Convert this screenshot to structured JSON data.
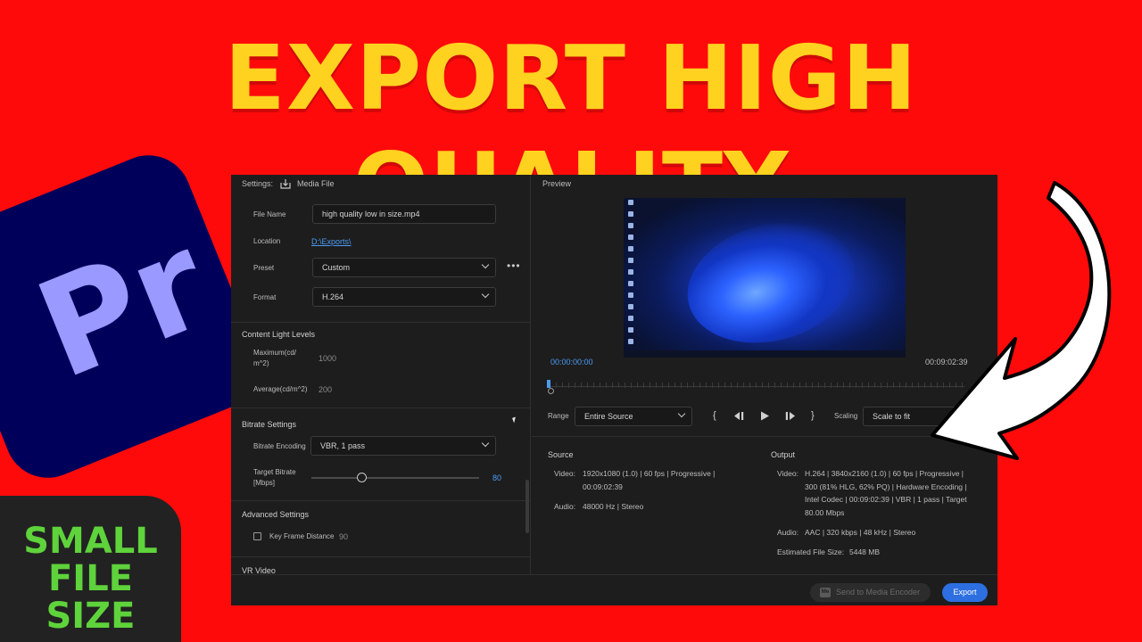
{
  "thumbnail": {
    "headline": "EXPORT HIGH QUALITY",
    "logo_text": "Pr",
    "badge_lines": [
      "SMALL",
      "FILE",
      "SIZE"
    ],
    "colors": {
      "background": "#ff0a0a",
      "headline": "#ffd21f",
      "badge_text": "#5ed33b",
      "logo_bg": "#00005b",
      "logo_text": "#9999ff"
    }
  },
  "settings": {
    "header_label": "Settings:",
    "media_file_label": "Media File",
    "media_file_icon": "export-icon",
    "file_name_label": "File Name",
    "file_name_value": "high quality low in size.mp4",
    "location_label": "Location",
    "location_value": "D:\\Exports\\",
    "preset_label": "Preset",
    "preset_value": "Custom",
    "format_label": "Format",
    "format_value": "H.264",
    "content_light_title": "Content Light Levels",
    "max_label_line1": "Maximum(cd/",
    "max_label_line2": "m^2)",
    "max_value": "1000",
    "avg_label": "Average(cd/m^2)",
    "avg_value": "200",
    "bitrate_title": "Bitrate Settings",
    "bitrate_encoding_label": "Bitrate Encoding",
    "bitrate_encoding_value": "VBR, 1 pass",
    "target_bitrate_line1": "Target Bitrate",
    "target_bitrate_line2": "[Mbps]",
    "target_bitrate_value": "80",
    "target_bitrate_fraction": 0.3,
    "advanced_title": "Advanced Settings",
    "key_frame_label": "Key Frame Distance",
    "key_frame_value": "90",
    "key_frame_checked": false,
    "vr_title": "VR Video"
  },
  "preview": {
    "title": "Preview",
    "timecode_start": "00:00:00:00",
    "timecode_end": "00:09:02:39",
    "range_label": "Range",
    "range_value": "Entire Source",
    "scaling_label": "Scaling",
    "scaling_value": "Scale to fit"
  },
  "source": {
    "title": "Source",
    "video_label": "Video:",
    "video_value": "1920x1080 (1.0) | 60 fps | Progressive | 00:09:02:39",
    "audio_label": "Audio:",
    "audio_value": "48000 Hz | Stereo"
  },
  "output": {
    "title": "Output",
    "video_label": "Video:",
    "video_value": "H.264 | 3840x2160 (1.0) | 60 fps | Progressive | 300 (81% HLG, 62% PQ) | Hardware Encoding | Intel Codec | 00:09:02:39 | VBR | 1 pass | Target 80.00 Mbps",
    "audio_label": "Audio:",
    "audio_value": "AAC | 320 kbps | 48 kHz | Stereo",
    "estimated_size_label": "Estimated File Size:",
    "estimated_size_value": "5448 MB"
  },
  "footer": {
    "send_to_encoder_label": "Send to Media Encoder",
    "encoder_icon_text": "Me",
    "export_label": "Export",
    "accent": "#2d6fe0"
  }
}
